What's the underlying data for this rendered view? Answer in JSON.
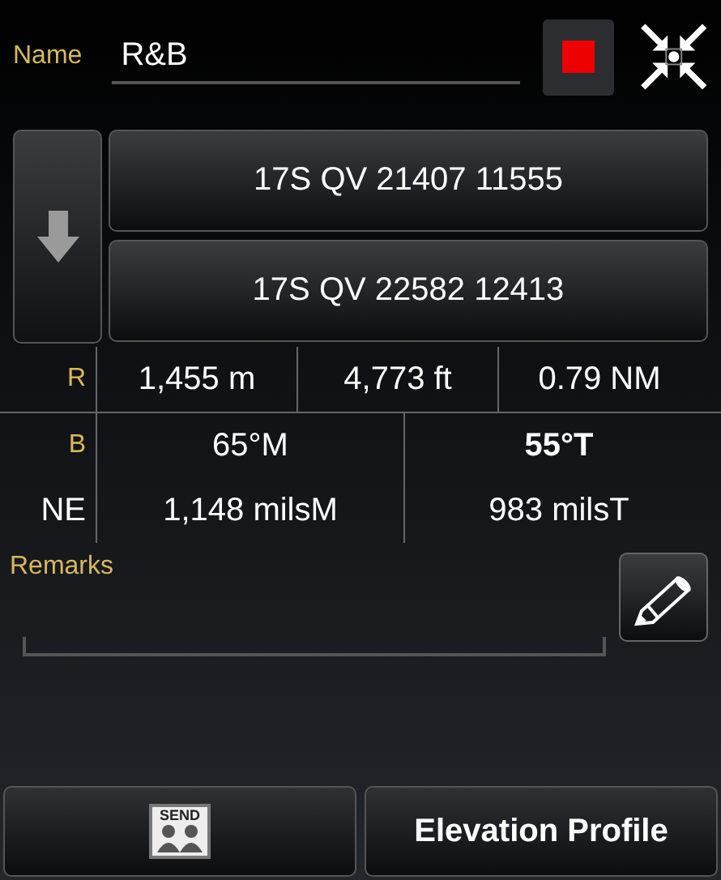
{
  "name_field": {
    "label": "Name",
    "value": "R&B"
  },
  "color_button": {
    "color": "#ee0000"
  },
  "coordinates": [
    "17S QV 21407 11555",
    "17S QV 22582 12413"
  ],
  "range": {
    "label": "R",
    "values": [
      "1,455 m",
      "4,773 ft",
      "0.79 NM"
    ]
  },
  "bearing": {
    "label": "B",
    "magnetic": "65°M",
    "true": "55°T"
  },
  "mils": {
    "label": "NE",
    "magnetic": "1,148 milsM",
    "true": "983 milsT"
  },
  "remarks": {
    "label": "Remarks"
  },
  "buttons": {
    "send_label": "SEND",
    "elevation": "Elevation Profile"
  }
}
